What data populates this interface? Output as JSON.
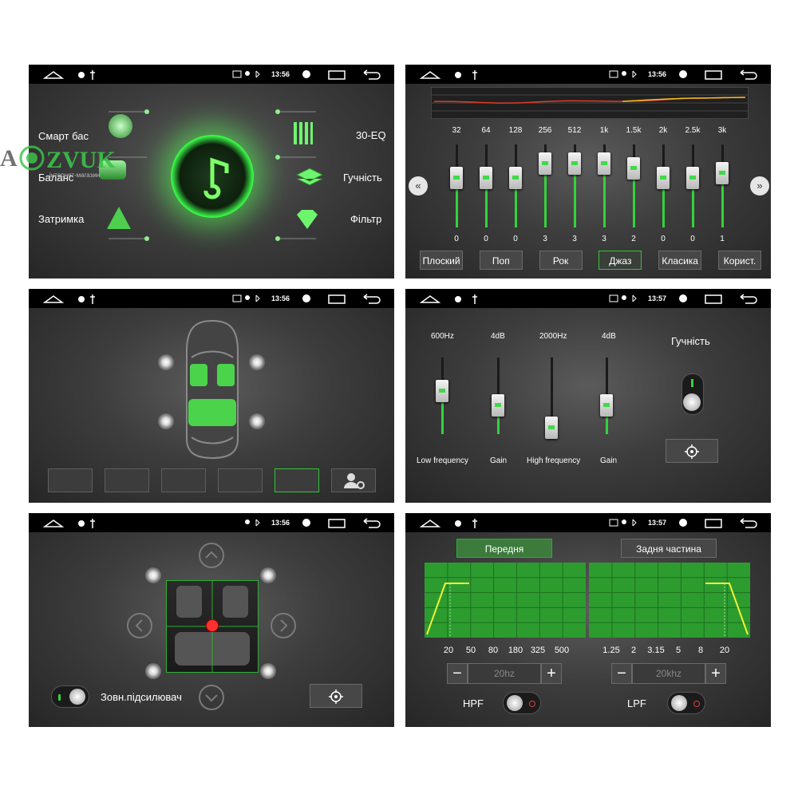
{
  "watermark": {
    "logo": "AVZVUK",
    "sub": "інтернет-магазин"
  },
  "status_time": [
    "13:56",
    "13:56",
    "13:56",
    "13:57",
    "13:56",
    "13:57"
  ],
  "panel1": {
    "left_items": [
      "Смарт бас",
      "Баланс",
      "Затримка"
    ],
    "right_items": [
      "30-EQ",
      "Гучність",
      "Фільтр"
    ]
  },
  "panel2": {
    "freqs": [
      "32",
      "64",
      "128",
      "256",
      "512",
      "1k",
      "1.5k",
      "2k",
      "2.5k",
      "3k"
    ],
    "values": [
      "0",
      "0",
      "0",
      "3",
      "3",
      "3",
      "2",
      "0",
      "0",
      "1"
    ],
    "levels": [
      0,
      0,
      0,
      3,
      3,
      3,
      2,
      0,
      0,
      1
    ],
    "presets": [
      "Плоский",
      "Поп",
      "Рок",
      "Джаз",
      "Класика",
      "Корист."
    ],
    "active_preset": "Джаз"
  },
  "panel4": {
    "top_labels": [
      "600Hz",
      "4dB",
      "2000Hz",
      "4dB"
    ],
    "bottom_labels": [
      "Low frequency",
      "Gain",
      "High frequency",
      "Gain"
    ],
    "volume_label": "Гучність"
  },
  "panel5": {
    "subwoofer_label": "Зовн.підсилювач"
  },
  "panel6": {
    "tabs": [
      "Передня",
      "Задня частина"
    ],
    "front_ticks": [
      "20",
      "50",
      "80",
      "180",
      "325",
      "500"
    ],
    "rear_ticks": [
      "1.25",
      "2",
      "3.15",
      "5",
      "8",
      "20"
    ],
    "hpf_value": "20hz",
    "lpf_value": "20khz",
    "hpf_label": "HPF",
    "lpf_label": "LPF",
    "minus": "−",
    "plus": "+"
  },
  "colors": {
    "accent": "#35d23b",
    "statusbar": "#000000",
    "panel_bg": "#3d3d3d"
  }
}
